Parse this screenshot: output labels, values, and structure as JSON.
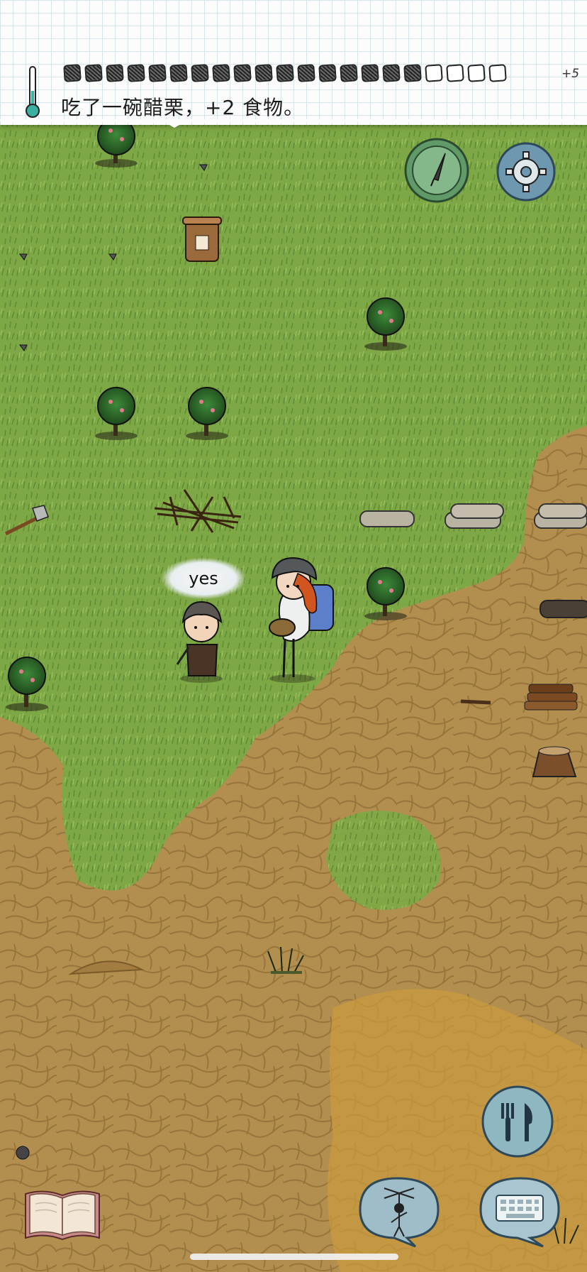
{
  "hud": {
    "message": "吃了一碗醋栗，+2 食物。",
    "food_bonus": "+5",
    "food_pips_filled": 17,
    "food_pips_total": 21,
    "temperature_icon": "thermometer-icon"
  },
  "buttons": {
    "compass": "compass-icon",
    "settings": "gear-icon",
    "eat": "fork-knife-icon",
    "emote": "puppet-icon",
    "keyboard": "keyboard-icon",
    "tech_book": "book-icon"
  },
  "chat": {
    "npc_speech": "yes"
  },
  "colors": {
    "grass": "#7fa546",
    "dirt": "#b18d4d",
    "hud_paper": "#fbfcfb",
    "button_green": "#5f9a68",
    "button_blue": "#6e98b0"
  }
}
